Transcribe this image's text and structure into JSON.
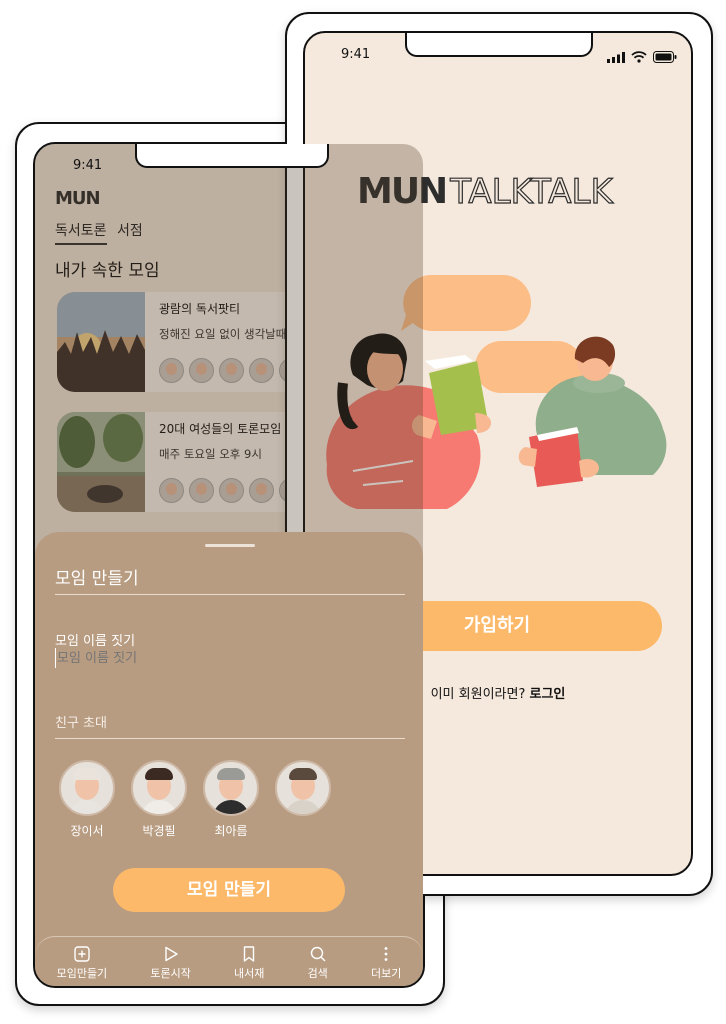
{
  "back_phone": {
    "time": "9:41",
    "logo": "MUN",
    "tabs": [
      {
        "label": "독서토론",
        "active": true
      },
      {
        "label": "서점",
        "active": false
      }
    ],
    "section_title": "내가 속한 모임",
    "groups": [
      {
        "name": "광람의 독서팟티",
        "description": "정해진 요일 없이 생각날때"
      },
      {
        "name": "20대 여성들의 토론모임",
        "description": "매주 토요일 오후 9시"
      }
    ],
    "sheet": {
      "title": "모임 만들기",
      "name_label": "모임 이름 짓기",
      "name_placeholder": "모임 이름 짓기",
      "invite_label": "친구 초대",
      "friends": [
        {
          "name": "장이서"
        },
        {
          "name": "박경필"
        },
        {
          "name": "최아름"
        }
      ],
      "create_button": "모임 만들기"
    },
    "bottom_nav": [
      {
        "label": "모임만들기",
        "icon": "plus-square-icon"
      },
      {
        "label": "토론시작",
        "icon": "play-icon"
      },
      {
        "label": "내서재",
        "icon": "bookmark-icon"
      },
      {
        "label": "검색",
        "icon": "search-icon"
      },
      {
        "label": "더보기",
        "icon": "more-vertical-icon"
      }
    ]
  },
  "front_phone": {
    "time": "9:41",
    "logo_mark": "MUN",
    "logo_text": "TALKTALK",
    "join_button": "가입하기",
    "login_prompt": "이미 회원이라면?",
    "login_link": "로그인"
  },
  "colors": {
    "accent": "#fdb96a",
    "front_bg": "#f5e9dd",
    "sheet_bg": "#b89c82",
    "speech_bubble": "#fdbd86",
    "woman_top": "#f77a72",
    "man_top": "#8fae8c",
    "book_green": "#a4bf4c",
    "book_red": "#e85a55"
  }
}
